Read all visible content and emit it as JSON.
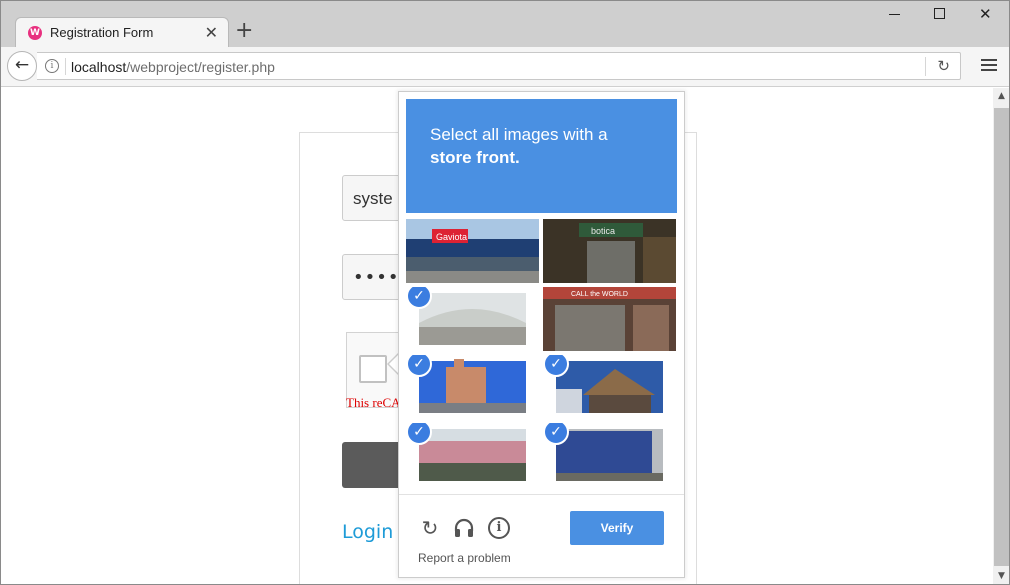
{
  "browser": {
    "tab_title": "Registration Form",
    "favicon": "W",
    "close_tab": "✕",
    "new_tab": "+",
    "url_host": "localhost",
    "url_path": "/webproject/register.php",
    "reload": "↻",
    "back": "←"
  },
  "form": {
    "username_value": "syste",
    "password_mask": "•••••",
    "recaptcha_error": "This reCA",
    "login_link": "Login"
  },
  "captcha": {
    "instruction_line1": "Select all images with a",
    "instruction_bold": "store front",
    "instruction_end": ".",
    "verify_label": "Verify",
    "report_label": "Report a problem",
    "check_glyph": "✓",
    "tiles_selected": [
      false,
      false,
      true,
      false,
      true,
      true,
      true,
      true
    ],
    "colors": {
      "accent": "#4a90e2",
      "check": "#3b7de0"
    }
  },
  "icons": {
    "reload_challenge": "↻",
    "audio": "🎧",
    "info": "i"
  }
}
